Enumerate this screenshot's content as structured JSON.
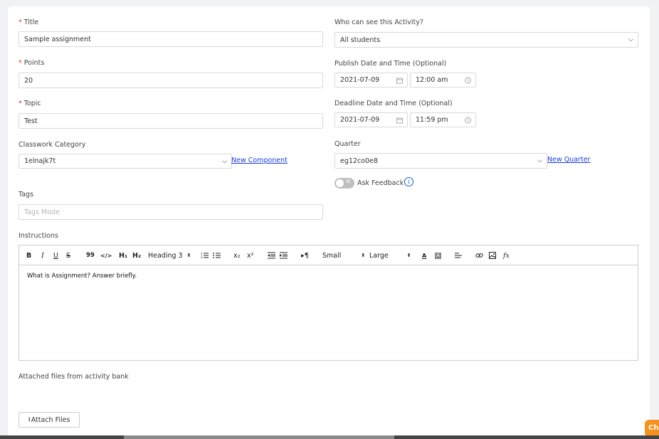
{
  "form": {
    "title": {
      "label": "Title",
      "value": "Sample assignment"
    },
    "points": {
      "label": "Points",
      "value": "20"
    },
    "topic": {
      "label": "Topic",
      "value": "Test"
    },
    "category": {
      "label": "Classwork Category",
      "value": "1elnajk7t",
      "link": "New Component"
    },
    "tags": {
      "label": "Tags",
      "placeholder": "Tags Mode"
    },
    "visibility": {
      "label": "Who can see this Activity?",
      "value": "All students"
    },
    "publish": {
      "label": "Publish Date and Time (Optional)",
      "date": "2021-07-09",
      "time": "12:00 am"
    },
    "deadline": {
      "label": "Deadline Date and Time (Optional)",
      "date": "2021-07-09",
      "time": "11:59 pm"
    },
    "quarter": {
      "label": "Quarter",
      "value": "eg12co0e8",
      "link": "New Quarter"
    },
    "feedback": {
      "label": "Ask Feedback",
      "info": "i"
    },
    "instructions": {
      "label": "Instructions",
      "content": "What is Assignment? Answer briefly."
    },
    "attached": {
      "label": "Attached files from activity bank",
      "button": "Attach Files"
    }
  },
  "toolbar": {
    "bold": "B",
    "italic": "I",
    "underline": "U",
    "strike": "S",
    "quote": "99",
    "code": "</>",
    "h1": "H₁",
    "h2": "H₂",
    "heading": "Heading 3",
    "size1": "Small",
    "size2": "Large",
    "sub": "x₂",
    "sup": "x²",
    "formula": "fx"
  },
  "chat": {
    "label": "Ch"
  }
}
